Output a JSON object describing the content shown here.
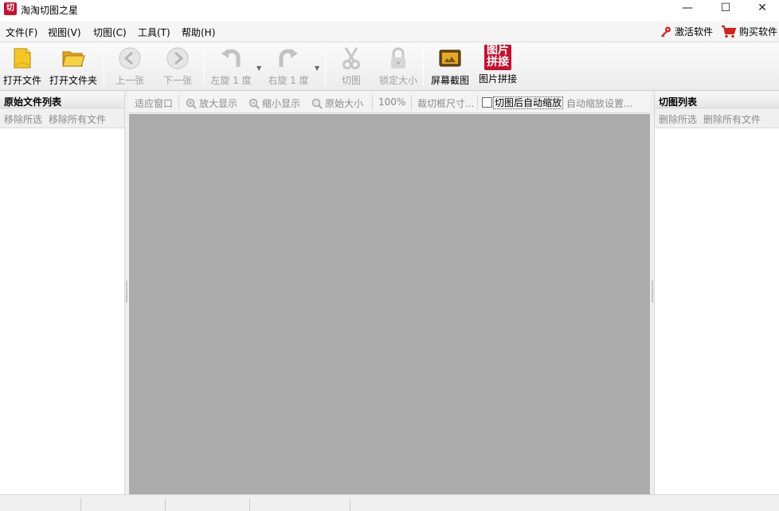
{
  "window": {
    "icon_text": "切",
    "title": "淘淘切图之星",
    "minimize": "—",
    "maximize": "☐",
    "close": "✕"
  },
  "menu": {
    "items": [
      "文件(F)",
      "视图(V)",
      "切图(C)",
      "工具(T)",
      "帮助(H)"
    ],
    "activate": "激活软件",
    "buy": "购买软件"
  },
  "toolbar": {
    "open_file": "打开文件",
    "open_folder": "打开文件夹",
    "prev": "上一张",
    "next": "下一张",
    "rotate_left": "左旋 1 度",
    "rotate_right": "右旋 1 度",
    "cut": "切图",
    "lock_size": "锁定大小",
    "screenshot": "屏幕截图",
    "stitch": "图片拼接",
    "stitch_icon_text_1": "图片",
    "stitch_icon_text_2": "拼接"
  },
  "left_panel": {
    "title": "原始文件列表",
    "remove_selected": "移除所选",
    "remove_all": "移除所有文件"
  },
  "right_panel": {
    "title": "切图列表",
    "delete_selected": "删除所选",
    "delete_all": "删除所有文件"
  },
  "center_bar": {
    "fit_window": "适应窗口",
    "zoom_in": "放大显示",
    "zoom_out": "缩小显示",
    "original_size": "原始大小",
    "zoom_level": "100%",
    "crop_size": "裁切框尺寸...",
    "auto_zoom_label": "切图后自动缩放",
    "auto_zoom_checked": false,
    "auto_zoom_settings": "自动缩放设置..."
  },
  "colors": {
    "canvas": "#ababab",
    "accent_red": "#c8102e"
  }
}
